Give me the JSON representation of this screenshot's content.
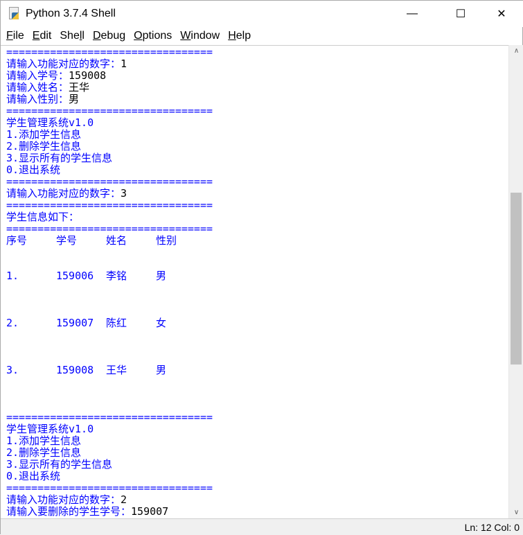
{
  "window": {
    "title": "Python 3.7.4 Shell",
    "minimize": "—",
    "maximize": "☐",
    "close": "✕"
  },
  "menu": [
    {
      "key": "F",
      "rest": "ile"
    },
    {
      "key": "E",
      "rest": "dit"
    },
    {
      "pre": "She",
      "key": "l",
      "rest": "l"
    },
    {
      "key": "D",
      "rest": "ebug"
    },
    {
      "key": "O",
      "rest": "ptions"
    },
    {
      "key": "W",
      "rest": "indow"
    },
    {
      "key": "H",
      "rest": "elp"
    }
  ],
  "shell": {
    "sep": "=================================",
    "prompt_func": "请输入功能对应的数字：",
    "prompt_id": "请输入学号：",
    "prompt_name": "请输入姓名：",
    "prompt_sex": "请输入性别：",
    "input1": "1",
    "input_id": "159008",
    "input_name": "王华",
    "input_sex": "男",
    "menu_title": "学生管理系统v1.0",
    "menu_items": [
      "1.添加学生信息",
      "2.删除学生信息",
      "3.显示所有的学生信息",
      "0.退出系统"
    ],
    "input3": "3",
    "info_header": "学生信息如下：",
    "table_headers": [
      "序号",
      "学号",
      "姓名",
      "性别"
    ],
    "table_rows": [
      [
        "1.",
        "159006",
        "李铭",
        "男"
      ],
      [
        "2.",
        "159007",
        "陈红",
        "女"
      ],
      [
        "3.",
        "159008",
        "王华",
        "男"
      ]
    ],
    "input2": "2",
    "prompt_delete": "请输入要删除的学生学号：",
    "input_delete": "159007"
  },
  "status": {
    "text": "Ln: 12  Col: 0"
  }
}
